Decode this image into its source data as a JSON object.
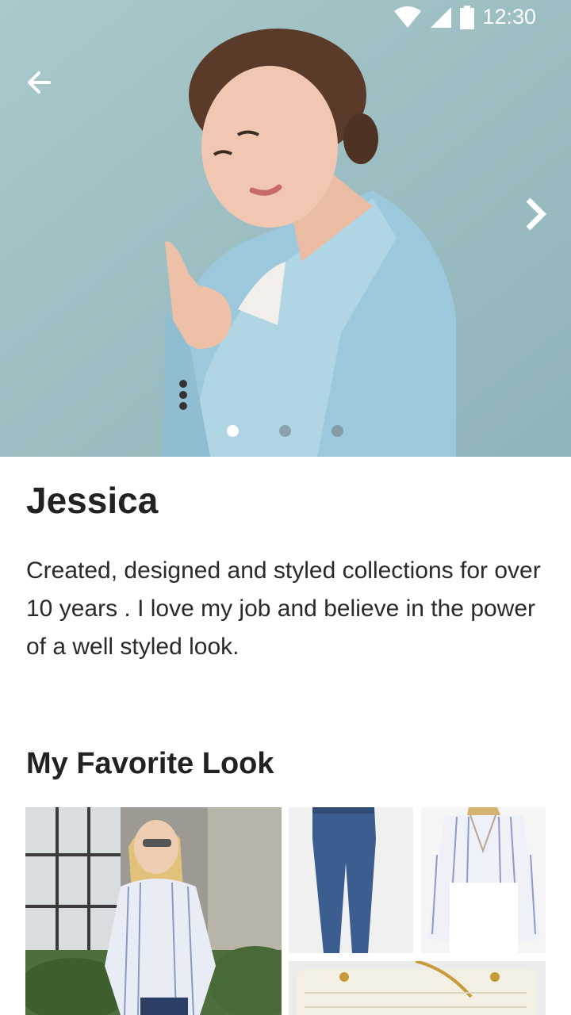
{
  "status_bar": {
    "time": "12:30",
    "icons": [
      "wifi-icon",
      "cellular-signal-icon",
      "battery-icon"
    ]
  },
  "hero": {
    "icons": {
      "back": "arrow-left-icon",
      "next": "chevron-right-icon"
    },
    "carousel": {
      "page_count": 3,
      "active_index": 0
    }
  },
  "profile": {
    "name": "Jessica",
    "bio": "Created, designed and styled collections for over 10 years . I love my job and believe in the power of a well styled look."
  },
  "favorite_look": {
    "title": "My Favorite Look",
    "items": [
      "outfit-photo",
      "jeans-photo",
      "striped-blouse-photo",
      "quilted-bag-photo"
    ]
  },
  "colors": {
    "hero_background": "#a6c6c9",
    "blazer": "#9cc8dc",
    "text_primary": "#222222",
    "dot_active": "#ffffff"
  }
}
